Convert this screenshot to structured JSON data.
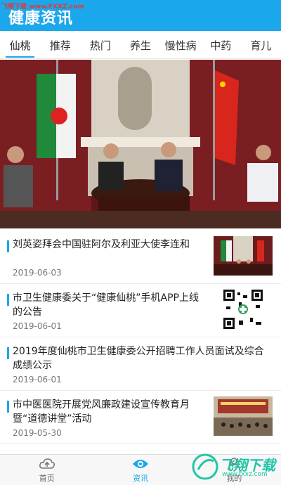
{
  "watermark_top": "飞翔下载 www.FXXZ.com",
  "header": {
    "title": "健康资讯"
  },
  "tabs": [
    {
      "label": "仙桃",
      "active": true
    },
    {
      "label": "推荐",
      "active": false
    },
    {
      "label": "热门",
      "active": false
    },
    {
      "label": "养生",
      "active": false
    },
    {
      "label": "慢性病",
      "active": false
    },
    {
      "label": "中药",
      "active": false
    },
    {
      "label": "育儿",
      "active": false
    }
  ],
  "news": [
    {
      "title": "刘英姿拜会中国驻阿尔及利亚大使李连和",
      "date": "2019-06-03",
      "thumb": "meeting-photo"
    },
    {
      "title": "市卫生健康委关于“健康仙桃”手机APP上线的公告",
      "date": "2019-06-01",
      "thumb": "qr-code"
    },
    {
      "title": "2019年度仙桃市卫生健康委公开招聘工作人员面试及综合成绩公示",
      "date": "2019-06-01",
      "thumb": ""
    },
    {
      "title": "市中医医院开展党风廉政建设宣传教育月暨“道德讲堂”活动",
      "date": "2019-05-30",
      "thumb": "lecture-photo"
    }
  ],
  "bottom_nav": [
    {
      "label": "首页",
      "icon": "home-cloud-icon",
      "active": false
    },
    {
      "label": "资讯",
      "icon": "eye-icon",
      "active": true
    },
    {
      "label": "我的",
      "icon": "user-icon",
      "active": false
    }
  ],
  "watermark_br": {
    "text": "飞翔下载",
    "sub": "www.fxxz.com"
  },
  "colors": {
    "accent": "#1aa7ec",
    "header_bg": "#1aa7ec"
  }
}
